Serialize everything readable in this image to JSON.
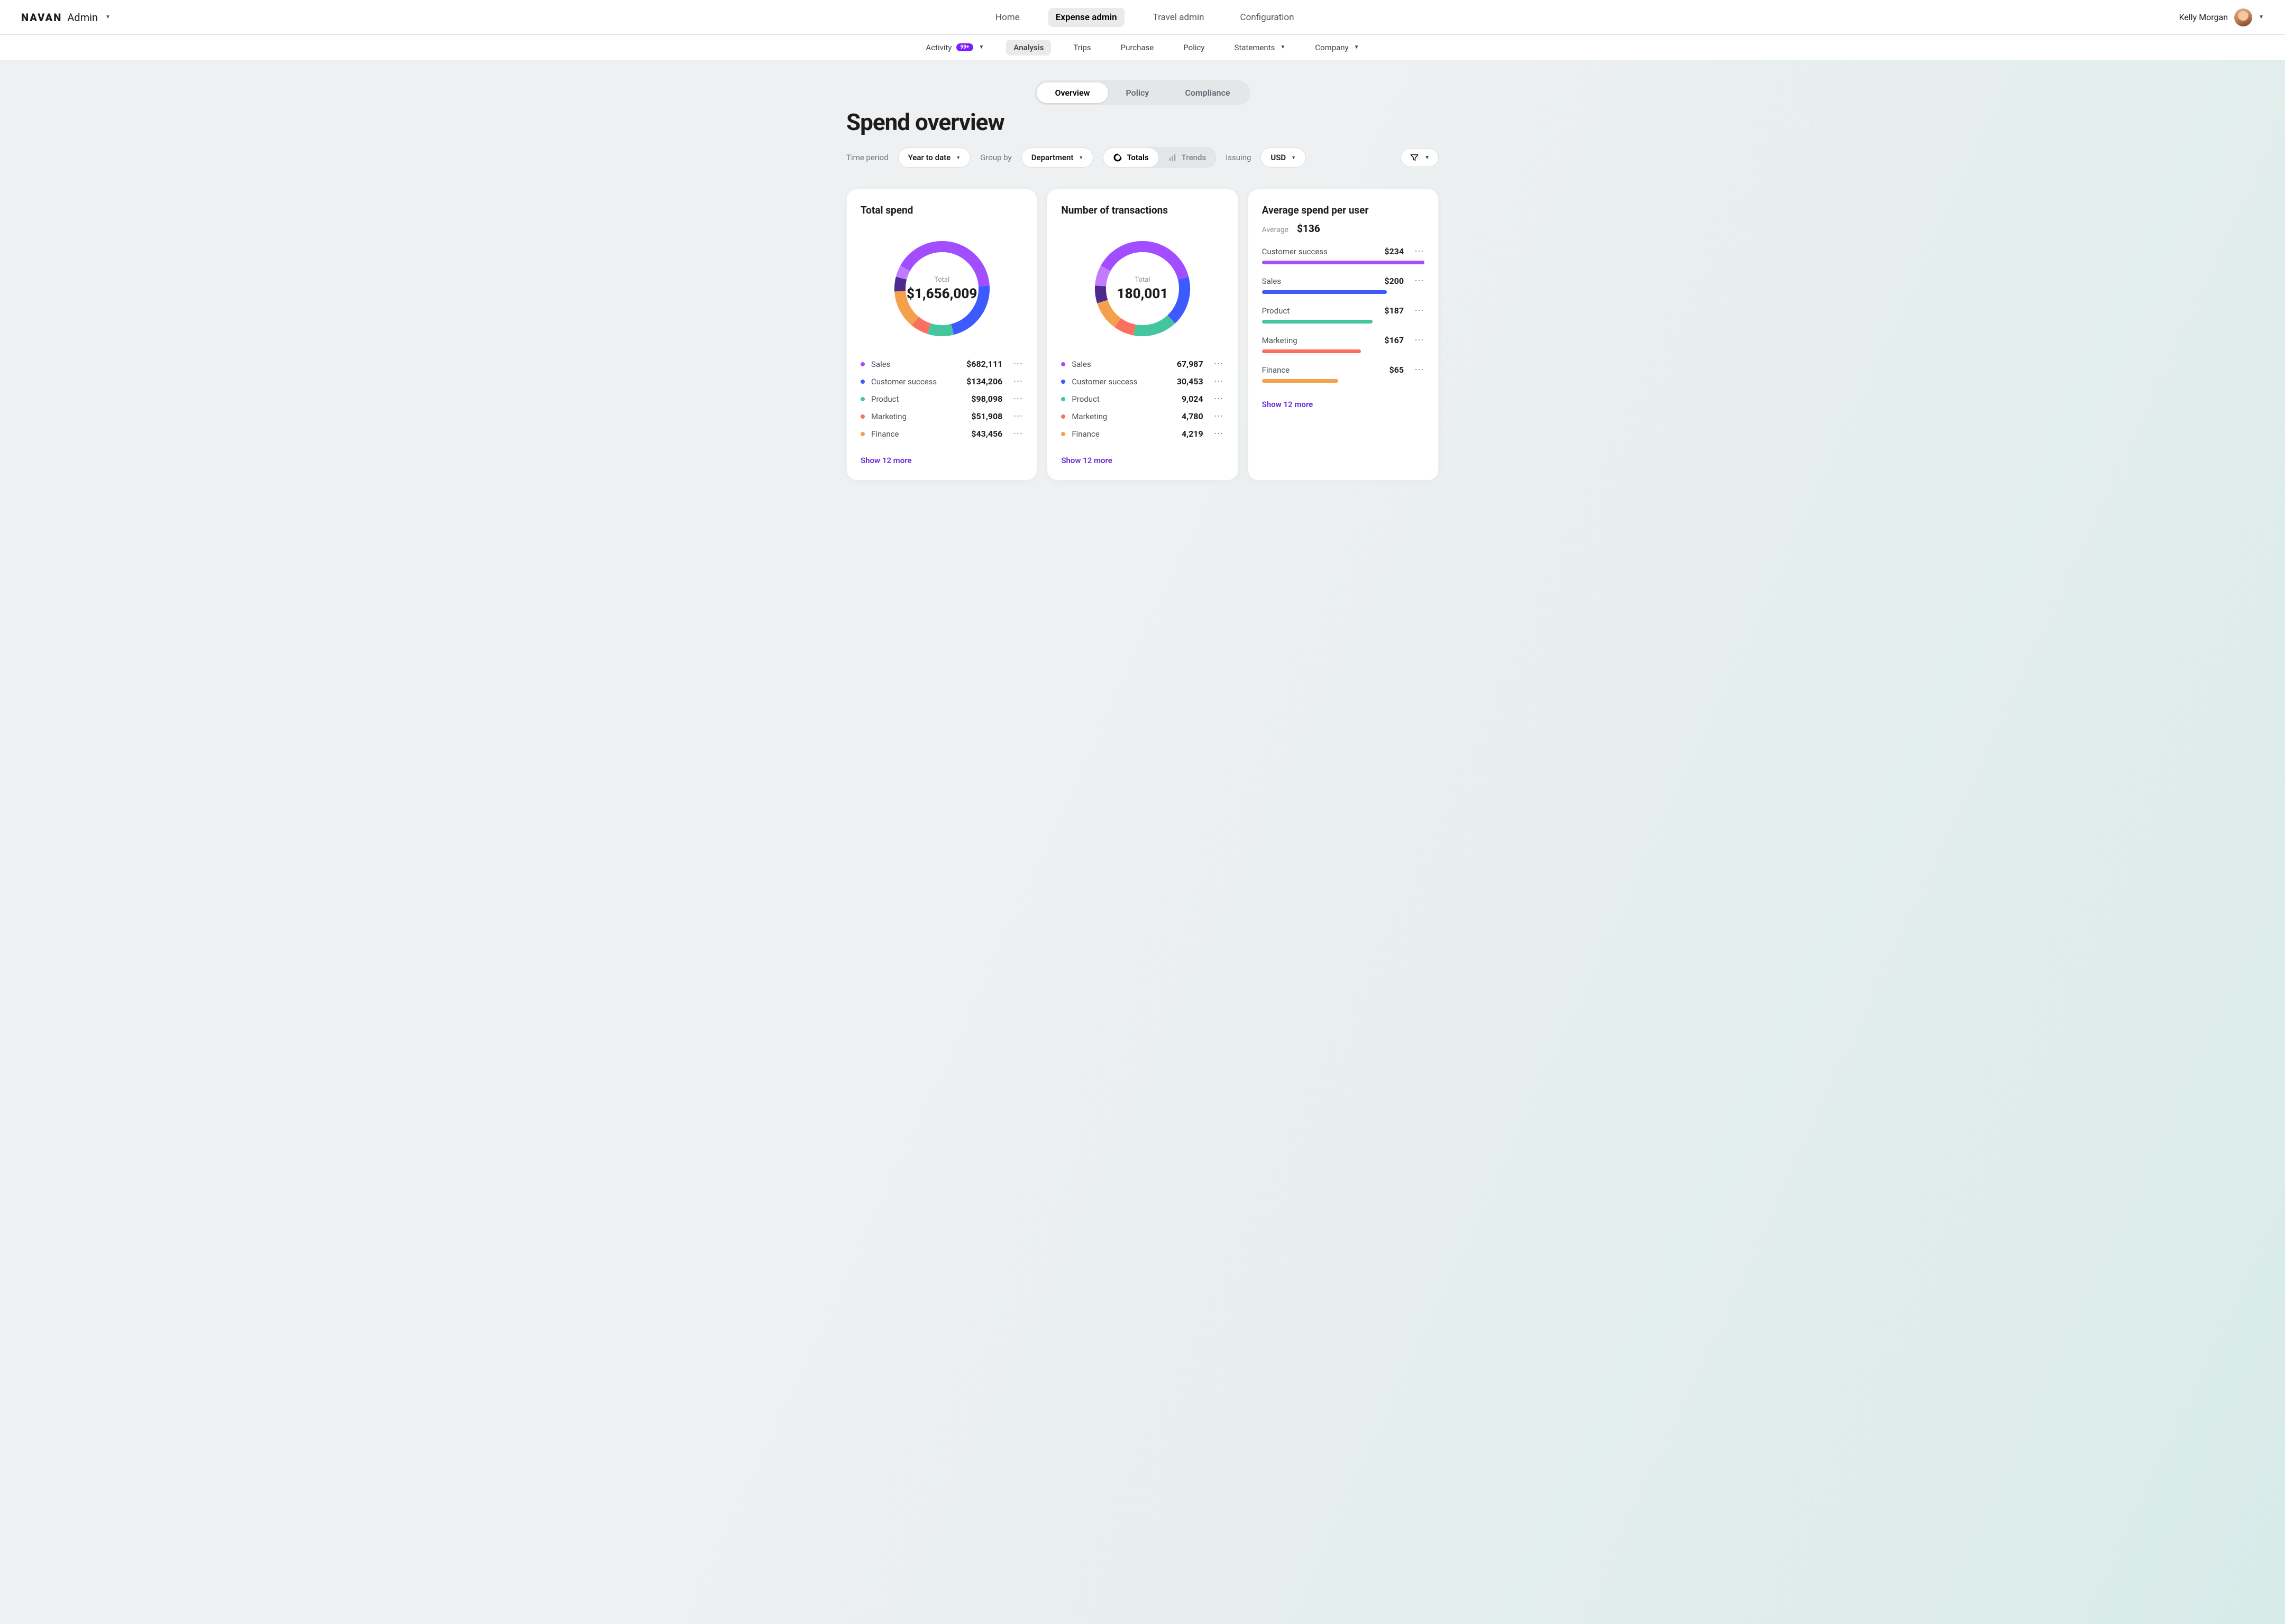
{
  "brand": {
    "mark": "NAVAN",
    "sub": "Admin"
  },
  "main_nav": {
    "items": [
      "Home",
      "Expense admin",
      "Travel admin",
      "Configuration"
    ],
    "active": 1
  },
  "user": {
    "name": "Kelly Morgan"
  },
  "sub_nav": {
    "items": [
      {
        "label": "Activity",
        "badge": "99+",
        "caret": true
      },
      {
        "label": "Analysis",
        "active": true
      },
      {
        "label": "Trips"
      },
      {
        "label": "Purchase"
      },
      {
        "label": "Policy"
      },
      {
        "label": "Statements",
        "caret": true
      },
      {
        "label": "Company",
        "caret": true
      }
    ]
  },
  "view_tabs": {
    "items": [
      "Overview",
      "Policy",
      "Compliance"
    ],
    "active": 0
  },
  "page_title": "Spend overview",
  "controls": {
    "time_label": "Time period",
    "time_value": "Year to date",
    "group_label": "Group by",
    "group_value": "Department",
    "totals": "Totals",
    "trends": "Trends",
    "issuing_label": "Issuing",
    "currency": "USD"
  },
  "cards": {
    "total_spend": {
      "title": "Total spend",
      "center_label": "Total",
      "center_value": "$1,656,009",
      "items": [
        {
          "name": "Sales",
          "value": "$682,111",
          "color": "#a24dff",
          "frac": 0.41
        },
        {
          "name": "Customer success",
          "value": "$134,206",
          "color": "#3d5afe",
          "frac": 0.22
        },
        {
          "name": "Product",
          "value": "$98,098",
          "color": "#45c4a0",
          "frac": 0.09
        },
        {
          "name": "Marketing",
          "value": "$51,908",
          "color": "#fb6f60",
          "frac": 0.06
        },
        {
          "name": "Finance",
          "value": "$43,456",
          "color": "#f5a04c",
          "frac": 0.13
        }
      ],
      "extra_slices": [
        {
          "color": "#4c2b8c",
          "frac": 0.05
        },
        {
          "color": "#c07bff",
          "frac": 0.04
        }
      ],
      "show_more": "Show 12 more"
    },
    "transactions": {
      "title": "Number of transactions",
      "center_label": "Total",
      "center_value": "180,001",
      "items": [
        {
          "name": "Sales",
          "value": "67,987",
          "color": "#a24dff",
          "frac": 0.38
        },
        {
          "name": "Customer success",
          "value": "30,453",
          "color": "#3d5afe",
          "frac": 0.17
        },
        {
          "name": "Product",
          "value": "9,024",
          "color": "#45c4a0",
          "frac": 0.15
        },
        {
          "name": "Marketing",
          "value": "4,780",
          "color": "#fb6f60",
          "frac": 0.07
        },
        {
          "name": "Finance",
          "value": "4,219",
          "color": "#f5a04c",
          "frac": 0.1
        }
      ],
      "extra_slices": [
        {
          "color": "#4c2b8c",
          "frac": 0.06
        },
        {
          "color": "#c07bff",
          "frac": 0.07
        }
      ],
      "show_more": "Show 12 more"
    },
    "avg_spend": {
      "title": "Average spend per user",
      "avg_label": "Average",
      "avg_value": "$136",
      "items": [
        {
          "name": "Customer success",
          "value": "$234",
          "color": "#a24dff",
          "frac": 1.0
        },
        {
          "name": "Sales",
          "value": "$200",
          "color": "#3d5afe",
          "frac": 0.77
        },
        {
          "name": "Product",
          "value": "$187",
          "color": "#45c4a0",
          "frac": 0.68
        },
        {
          "name": "Marketing",
          "value": "$167",
          "color": "#fb6f60",
          "frac": 0.61
        },
        {
          "name": "Finance",
          "value": "$65",
          "color": "#f5a04c",
          "frac": 0.47
        }
      ],
      "show_more": "Show 12 more"
    }
  },
  "chart_data": [
    {
      "type": "pie",
      "title": "Total spend",
      "categories": [
        "Sales",
        "Customer success",
        "Product",
        "Marketing",
        "Finance"
      ],
      "values": [
        682111,
        134206,
        98098,
        51908,
        43456
      ],
      "total": 1656009
    },
    {
      "type": "pie",
      "title": "Number of transactions",
      "categories": [
        "Sales",
        "Customer success",
        "Product",
        "Marketing",
        "Finance"
      ],
      "values": [
        67987,
        30453,
        9024,
        4780,
        4219
      ],
      "total": 180001
    },
    {
      "type": "bar",
      "title": "Average spend per user",
      "categories": [
        "Customer success",
        "Sales",
        "Product",
        "Marketing",
        "Finance"
      ],
      "values": [
        234,
        200,
        187,
        167,
        65
      ],
      "ylabel": "USD",
      "average": 136
    }
  ]
}
